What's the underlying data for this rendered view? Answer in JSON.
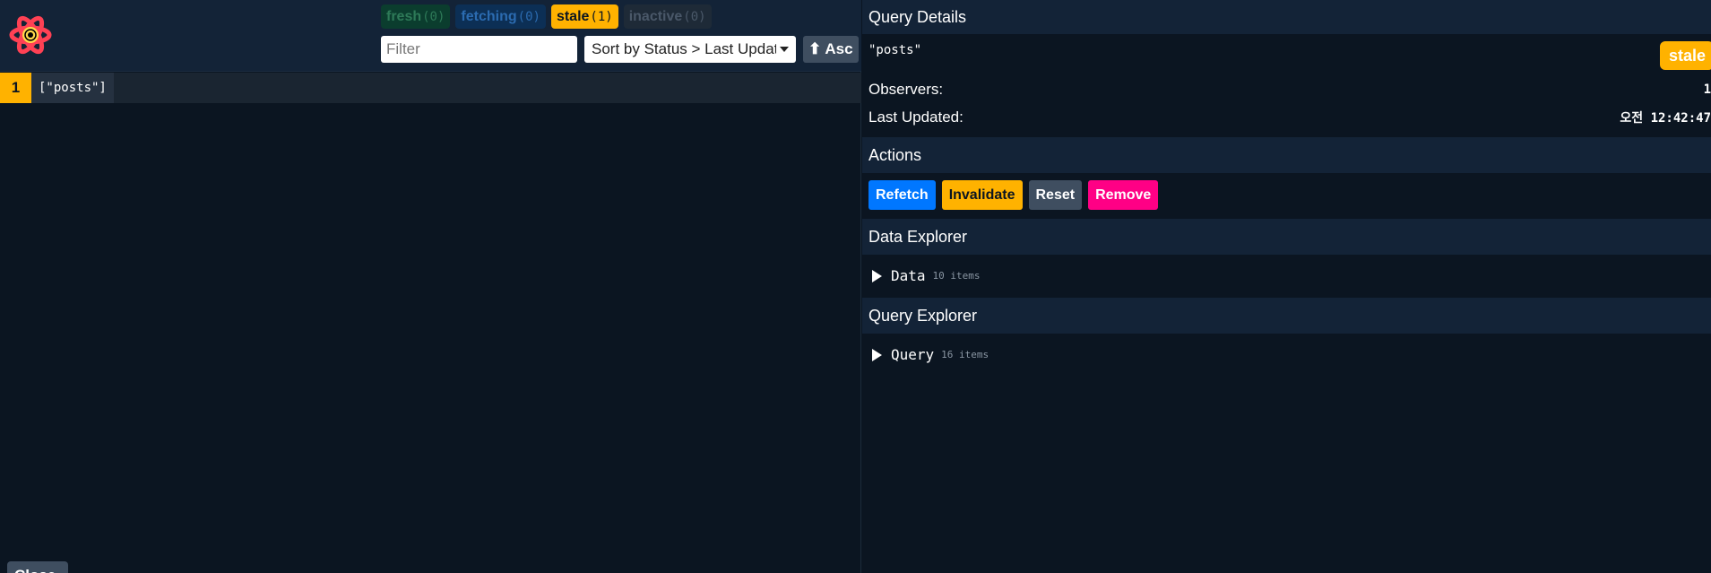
{
  "status_counts": [
    {
      "label": "fresh",
      "count": "(0)"
    },
    {
      "label": "fetching",
      "count": "(0)"
    },
    {
      "label": "stale",
      "count": "(1)"
    },
    {
      "label": "inactive",
      "count": "(0)"
    }
  ],
  "filter": {
    "placeholder": "Filter",
    "value": ""
  },
  "sort": {
    "selected": "Sort by Status > Last Updated"
  },
  "sort_direction": "⬆ Asc",
  "query_list": [
    {
      "observers": "1",
      "key": "[\"posts\"]"
    }
  ],
  "close_button": "Close",
  "details": {
    "header": "Query Details",
    "key": "\"posts\"",
    "status": "stale",
    "observers_label": "Observers:",
    "observers_value": "1",
    "last_updated_label": "Last Updated:",
    "last_updated_value": "오전 12:42:47"
  },
  "actions": {
    "header": "Actions",
    "refetch": "Refetch",
    "invalidate": "Invalidate",
    "reset": "Reset",
    "remove": "Remove"
  },
  "data_explorer": {
    "header": "Data Explorer",
    "label": "Data",
    "info": "10 items"
  },
  "query_explorer": {
    "header": "Query Explorer",
    "label": "Query",
    "info": "16 items"
  },
  "colors": {
    "fresh": "#0b3d2e",
    "fetching": "#0c2f55",
    "stale": "#ffb200",
    "inactive": "#1e2a37",
    "refetch": "#0077ff",
    "remove": "#ff0085"
  },
  "icons": {
    "logo": "react-query-logo-icon",
    "sort_caret": "chevron-down-icon",
    "expand": "triangle-right-icon"
  }
}
